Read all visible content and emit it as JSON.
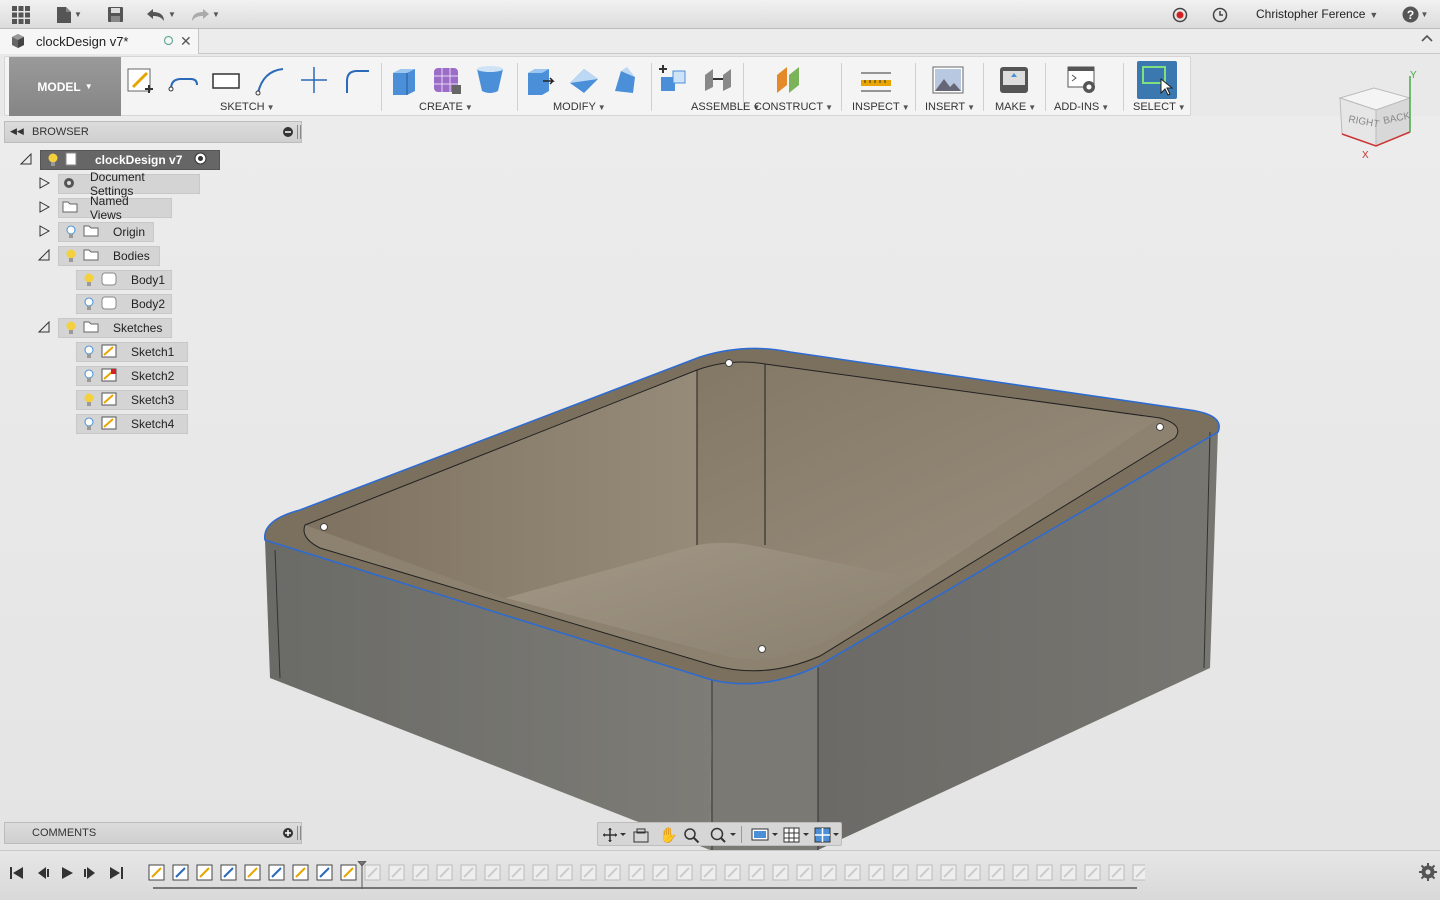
{
  "app": {
    "user_name": "Christopher Ference",
    "doc_tab_title": "clockDesign v7*"
  },
  "toolbar": {
    "workspace": "MODEL",
    "groups": {
      "sketch": "SKETCH",
      "create": "CREATE",
      "modify": "MODIFY",
      "assemble": "ASSEMBLE",
      "construct": "CONSTRUCT",
      "inspect": "INSPECT",
      "insert": "INSERT",
      "make": "MAKE",
      "addins": "ADD-INS",
      "select": "SELECT"
    }
  },
  "browser": {
    "title": "BROWSER",
    "root": "clockDesign v7",
    "items": {
      "document_settings": "Document Settings",
      "named_views": "Named Views",
      "origin": "Origin",
      "bodies": "Bodies",
      "body1": "Body1",
      "body2": "Body2",
      "sketches": "Sketches",
      "sketch1": "Sketch1",
      "sketch2": "Sketch2",
      "sketch3": "Sketch3",
      "sketch4": "Sketch4"
    }
  },
  "comments": {
    "title": "COMMENTS"
  },
  "viewcube": {
    "right": "RIGHT",
    "back": "BACK",
    "axis_x": "X",
    "axis_y": "Y"
  },
  "colors": {
    "accent_blue": "#2e6bd0",
    "select_active": "#3c78b0",
    "body_top": "#7a6e5c",
    "body_side": "#6f6f6f"
  }
}
